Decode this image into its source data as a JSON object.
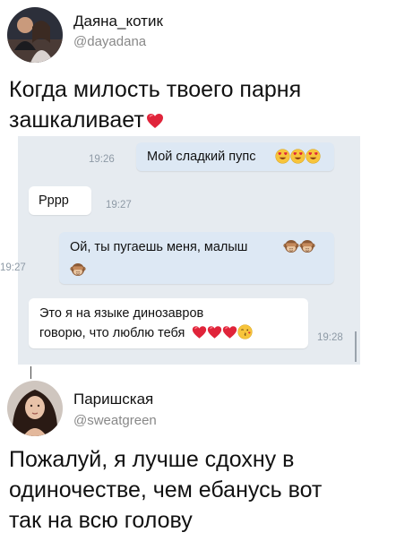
{
  "tweet1": {
    "name": "Даяна_котик",
    "handle": "@dayadana",
    "text_line1": "Когда милость твоего парня",
    "text_line2": "зашкаливает"
  },
  "chat": {
    "messages": [
      {
        "dir": "out",
        "text": "Мой сладкий пупс",
        "time": "19:26",
        "emoji": [
          "heart-eyes-icon",
          "heart-eyes-icon",
          "heart-eyes-icon"
        ]
      },
      {
        "dir": "in",
        "text": "Рррр",
        "time": "19:27"
      },
      {
        "dir": "out",
        "text": "Ой, ты пугаешь меня, малыш",
        "time": "19:27",
        "emoji": [
          "see-no-evil-monkey-icon",
          "see-no-evil-monkey-icon",
          "see-no-evil-monkey-icon"
        ]
      },
      {
        "dir": "in",
        "text_line1": "Это я на языке динозавров",
        "text_line2": "говорю, что люблю тебя",
        "time": "19:28",
        "emoji": [
          "red-heart-icon",
          "red-heart-icon",
          "red-heart-icon",
          "kissing-face-icon"
        ]
      }
    ]
  },
  "tweet2": {
    "name": "Паришская",
    "handle": "@sweatgreen",
    "text_line1": "Пожалуй, я лучше сдохну в",
    "text_line2": "одиночестве, чем ебанусь вот",
    "text_line3": "так на всю голову"
  },
  "colors": {
    "chat_bg": "#e6ebf0",
    "bubble_out": "#dde8f4",
    "bubble_in": "#ffffff",
    "heart": "#e0243a"
  }
}
